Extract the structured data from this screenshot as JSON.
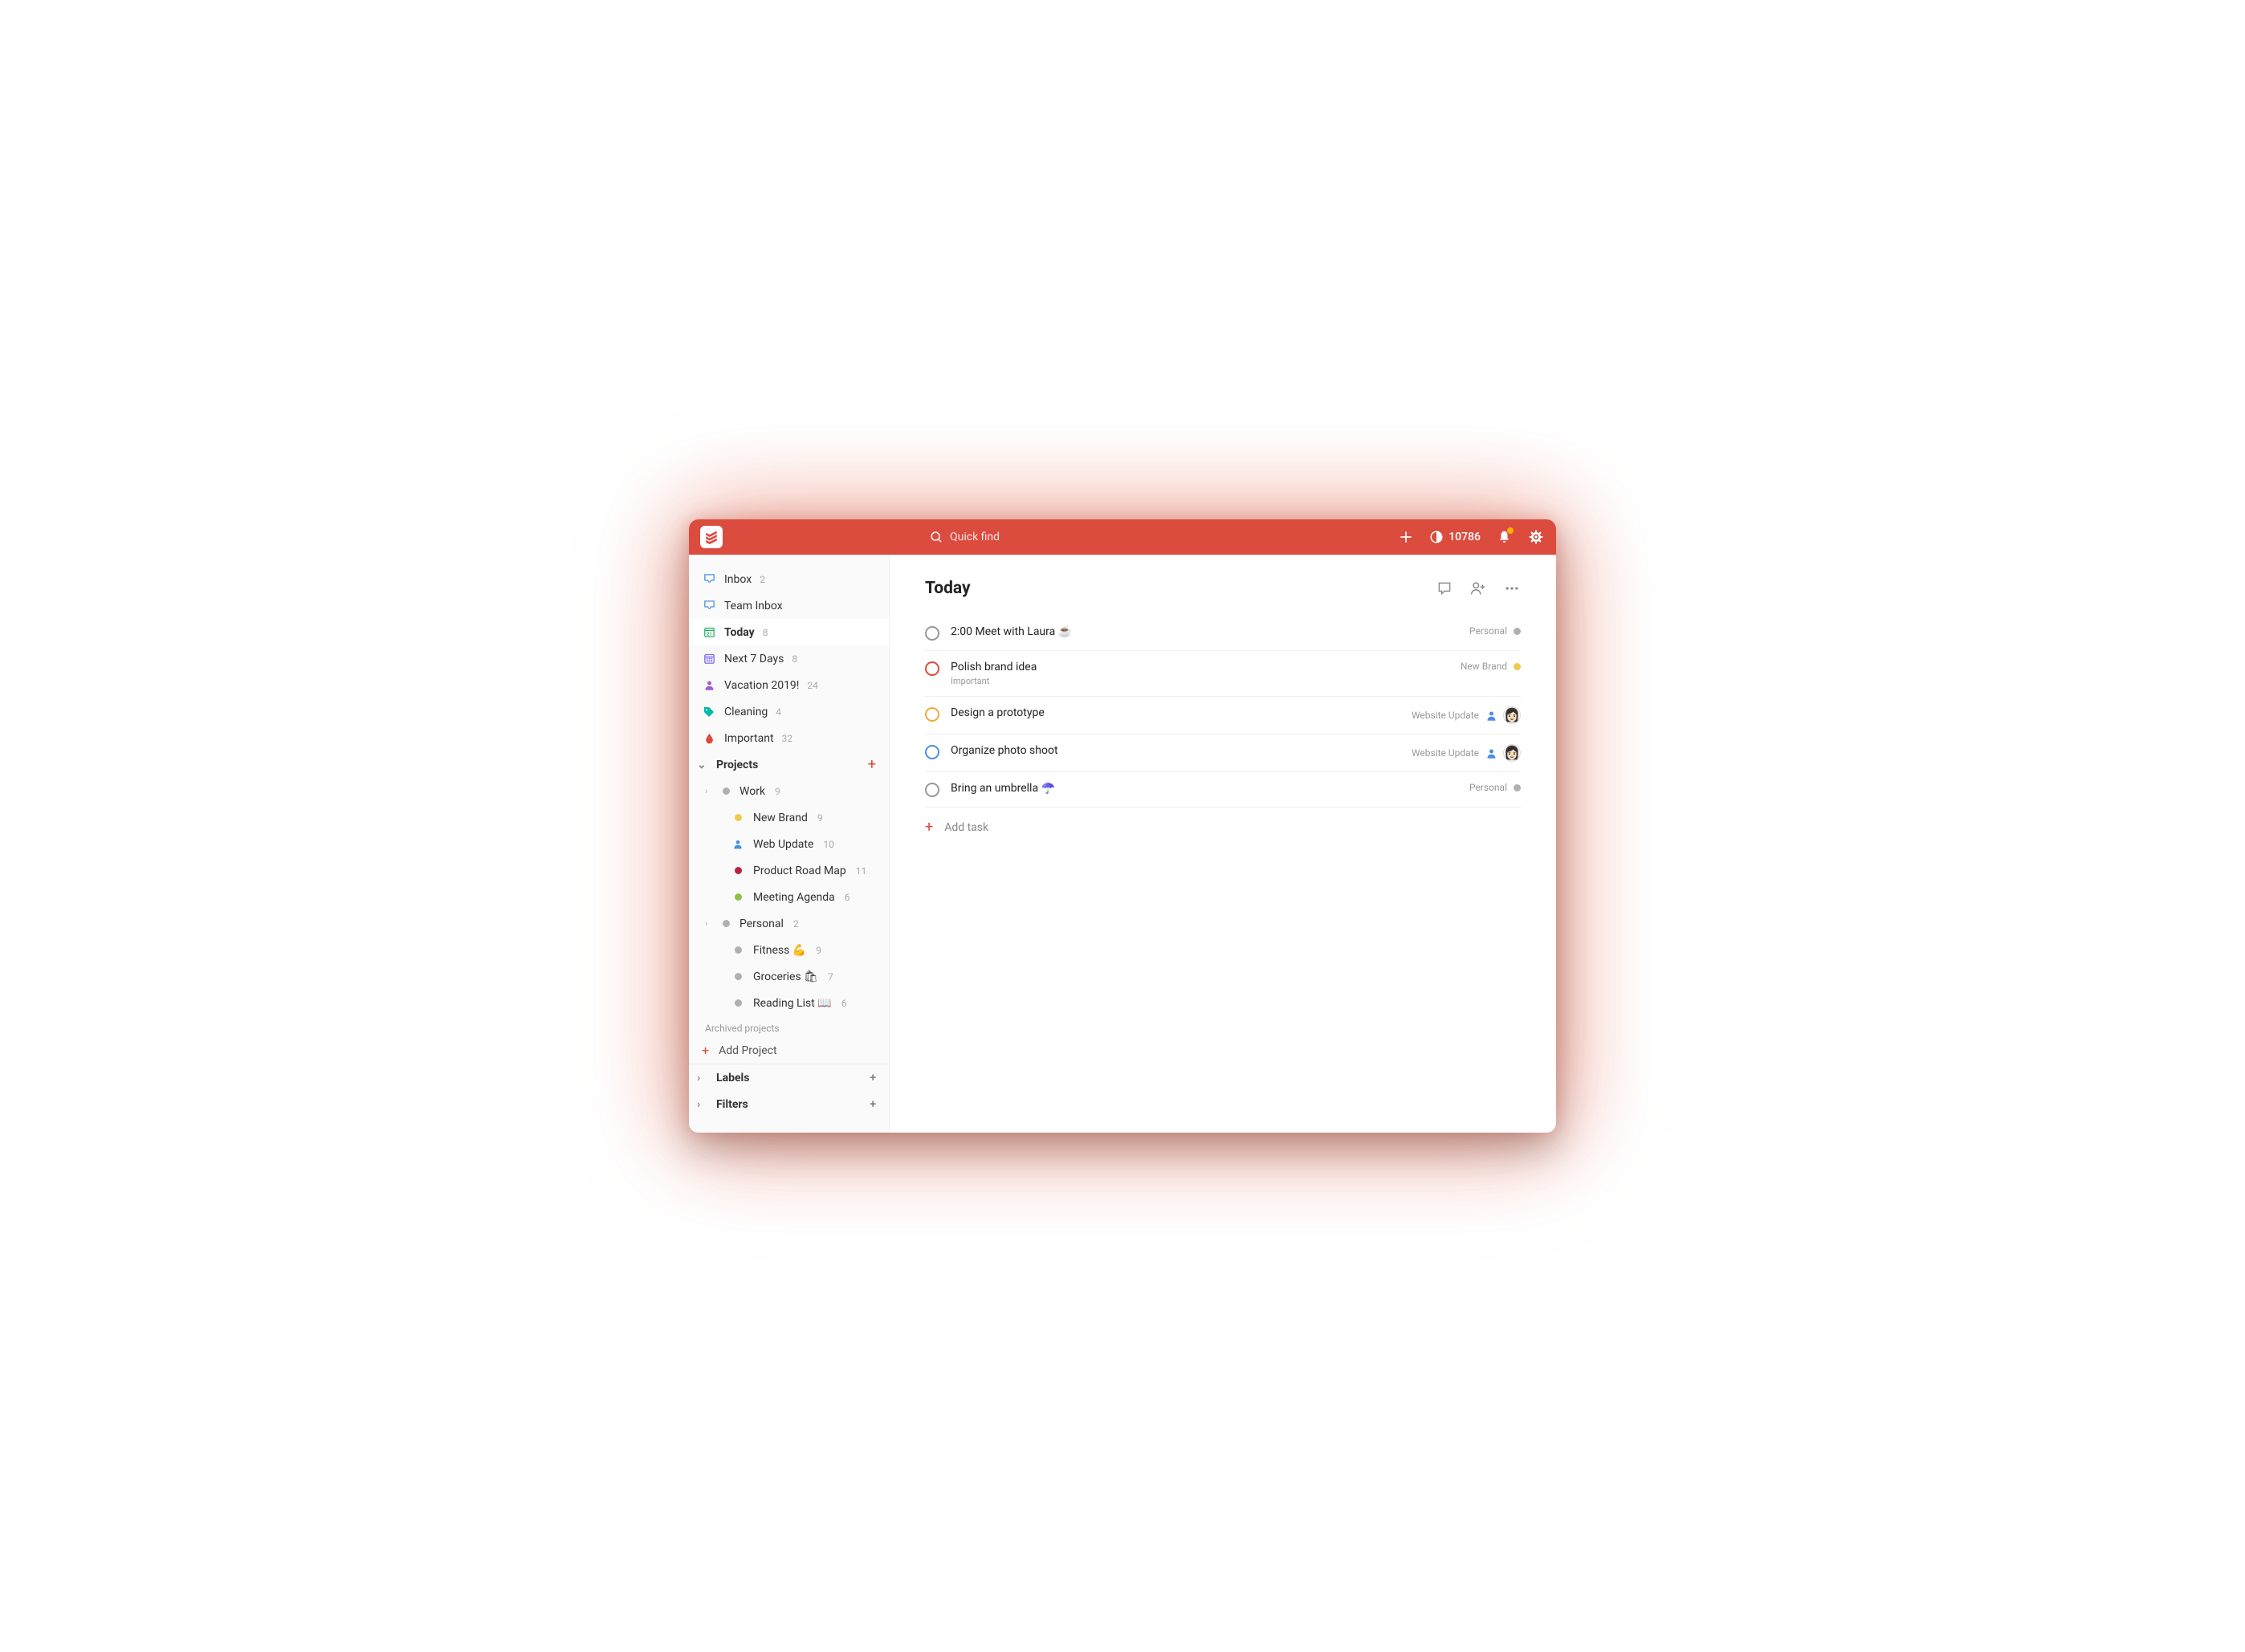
{
  "topbar": {
    "search_placeholder": "Quick find",
    "karma_count": "10786"
  },
  "sidebar": {
    "nav": [
      {
        "label": "Inbox",
        "count": "2",
        "icon": "inbox",
        "color": "#4A90E2"
      },
      {
        "label": "Team Inbox",
        "count": "",
        "icon": "inbox",
        "color": "#4A90E2"
      },
      {
        "label": "Today",
        "count": "8",
        "icon": "calendar-today",
        "color": "#1FAE5F",
        "active": true
      },
      {
        "label": "Next 7 Days",
        "count": "8",
        "icon": "calendar-week",
        "color": "#7B68EE"
      },
      {
        "label": "Vacation 2019!",
        "count": "24",
        "icon": "person",
        "color": "#A259D9"
      },
      {
        "label": "Cleaning",
        "count": "4",
        "icon": "tag",
        "color": "#00B8A9"
      },
      {
        "label": "Important",
        "count": "32",
        "icon": "drop",
        "color": "#DB4C3F"
      }
    ],
    "projects_label": "Projects",
    "projects": [
      {
        "name": "Work",
        "count": "9",
        "color": "#b0b0b0",
        "expandable": true,
        "children": [
          {
            "name": "New Brand",
            "count": "9",
            "color": "#F2C94C"
          },
          {
            "name": "Web Update",
            "count": "10",
            "color": "#4A90E2",
            "icon": "person"
          },
          {
            "name": "Product Road Map",
            "count": "11",
            "color": "#B8233E"
          },
          {
            "name": "Meeting Agenda",
            "count": "6",
            "color": "#8BC34A"
          }
        ]
      },
      {
        "name": "Personal",
        "count": "2",
        "color": "#b0b0b0",
        "expandable": true,
        "children": [
          {
            "name": "Fitness 💪",
            "count": "9",
            "color": "#b0b0b0"
          },
          {
            "name": "Groceries 🛍",
            "count": "7",
            "color": "#b0b0b0"
          },
          {
            "name": "Reading List 📖",
            "count": "6",
            "color": "#b0b0b0"
          }
        ]
      }
    ],
    "archived_label": "Archived projects",
    "add_project_label": "Add Project",
    "labels_label": "Labels",
    "filters_label": "Filters"
  },
  "main": {
    "title": "Today",
    "add_task_label": "Add task",
    "tasks": [
      {
        "title": "2:00 Meet with Laura ☕️",
        "subtitle": "",
        "check_color": "#999",
        "project": "Personal",
        "dot_color": "#b0b0b0",
        "assigned": false,
        "avatar": false
      },
      {
        "title": "Polish brand idea",
        "subtitle": "Important",
        "check_color": "#DB4C3F",
        "project": "New Brand",
        "dot_color": "#F2C94C",
        "assigned": false,
        "avatar": false
      },
      {
        "title": "Design a prototype",
        "subtitle": "",
        "check_color": "#F2A93B",
        "project": "Website Update",
        "dot_color": "",
        "assigned": true,
        "avatar": true
      },
      {
        "title": "Organize photo shoot",
        "subtitle": "",
        "check_color": "#4A90E2",
        "project": "Website Update",
        "dot_color": "",
        "assigned": true,
        "avatar": true
      },
      {
        "title": "Bring an umbrella ☂️",
        "subtitle": "",
        "check_color": "#999",
        "project": "Personal",
        "dot_color": "#b0b0b0",
        "assigned": false,
        "avatar": false
      }
    ]
  }
}
